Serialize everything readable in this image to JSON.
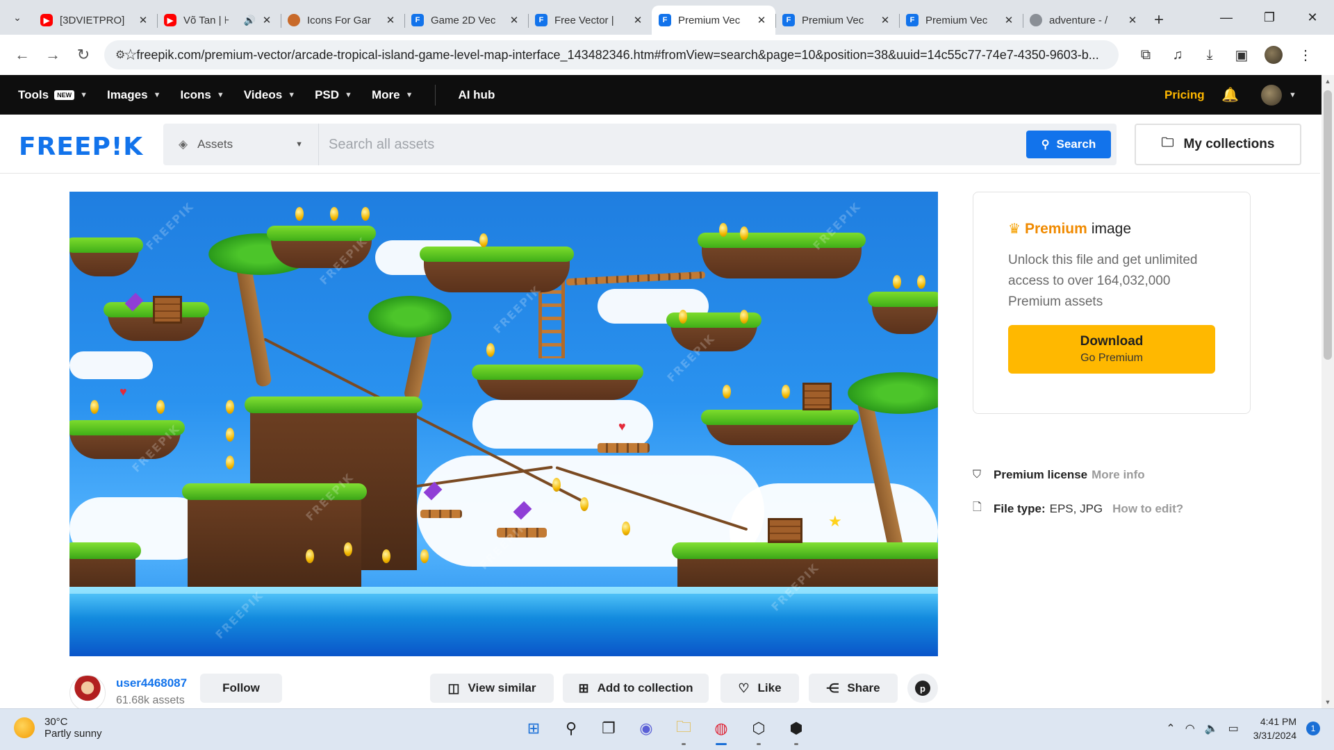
{
  "browser": {
    "tabs": [
      {
        "title": "[3DVIETPRO]",
        "icon": "youtube-icon",
        "active": false
      },
      {
        "title": "Võ Tan | ⊦",
        "icon": "youtube-icon",
        "active": false,
        "audio": true
      },
      {
        "title": "Icons For Gar",
        "icon": "game-icon",
        "active": false
      },
      {
        "title": "Game 2D Vec",
        "icon": "freepik-icon",
        "active": false
      },
      {
        "title": "Free Vector | ",
        "icon": "freepik-icon",
        "active": false
      },
      {
        "title": "Premium Vec",
        "icon": "freepik-icon",
        "active": true
      },
      {
        "title": "Premium Vec",
        "icon": "freepik-icon",
        "active": false
      },
      {
        "title": "Premium Vec",
        "icon": "freepik-icon",
        "active": false
      },
      {
        "title": "adventure - /",
        "icon": "unity-icon",
        "active": false
      }
    ],
    "url": "freepik.com/premium-vector/arcade-tropical-island-game-level-map-interface_143482346.htm#fromView=search&page=10&position=38&uuid=14c55c77-74e7-4350-9603-b..."
  },
  "nav": {
    "tools": "Tools",
    "tools_badge": "NEW",
    "images": "Images",
    "icons": "Icons",
    "videos": "Videos",
    "psd": "PSD",
    "more": "More",
    "ai_hub": "AI hub",
    "pricing": "Pricing"
  },
  "header": {
    "logo": "FREEP!K",
    "assets_label": "Assets",
    "search_placeholder": "Search all assets",
    "search_button": "Search",
    "my_collections": "My collections"
  },
  "premium": {
    "title_accent": "Premium",
    "title_rest": "image",
    "description": "Unlock this file and get unlimited access to over 164,032,000 Premium assets",
    "download_label": "Download",
    "download_sub": "Go Premium"
  },
  "meta": {
    "license_label": "Premium license",
    "license_link": "More info",
    "filetype_label": "File type:",
    "filetype_value": "EPS, JPG",
    "filetype_link": "How to edit?"
  },
  "author": {
    "name": "user4468087",
    "assets": "61.68k assets",
    "follow": "Follow"
  },
  "actions": {
    "view_similar": "View similar",
    "add_to_collection": "Add to collection",
    "like": "Like",
    "share": "Share"
  },
  "taskbar": {
    "temperature": "30°C",
    "weather": "Partly sunny",
    "time": "4:41 PM",
    "date": "3/31/2024",
    "notifications": "1"
  },
  "preview": {
    "watermark": "FREEPIK"
  },
  "colors": {
    "brand_blue": "#1273eb",
    "premium_yellow": "#ffb800",
    "nav_bg": "#0e0e0e",
    "pricing": "#ffb800"
  }
}
